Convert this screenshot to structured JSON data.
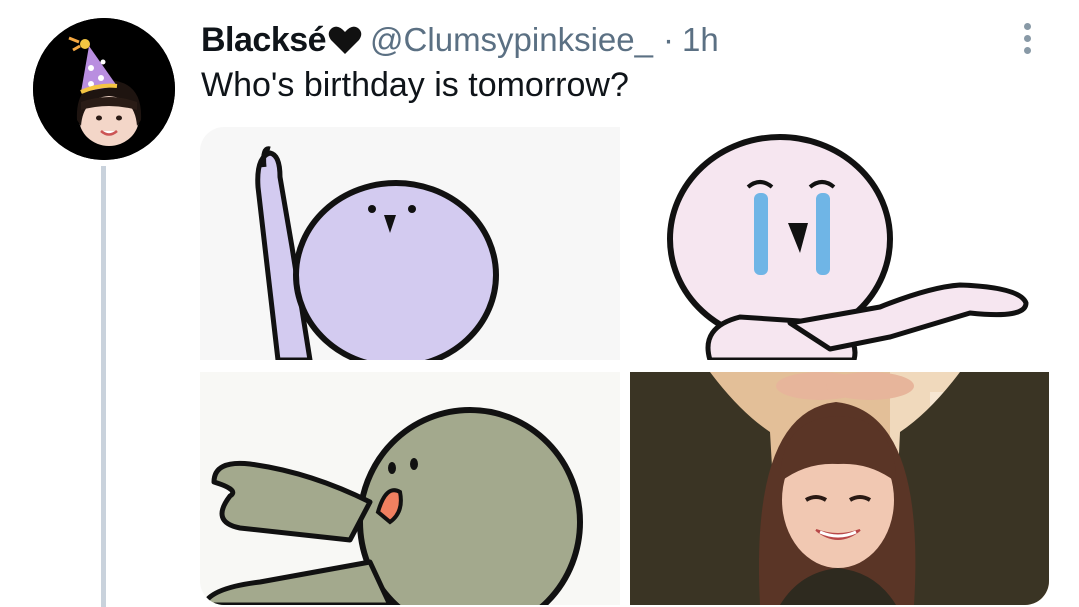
{
  "tweet": {
    "display_name": "Blacksé",
    "handle": "@Clumsypinksiee_",
    "separator": "·",
    "time": "1h",
    "text": "Who's birthday is tomorrow?"
  },
  "avatar": {
    "icon": "party-hat-avatar",
    "background_color": "#000000",
    "hat_color": "#b98ee0"
  },
  "display_name_emoji": "black-heart-icon",
  "media": [
    {
      "name": "purple-blob-raising-hand",
      "body_color": "#d3cbf0"
    },
    {
      "name": "pink-blob-crying-pointing",
      "body_color": "#f6e6f0",
      "tear_color": "#6fb5e6"
    },
    {
      "name": "gray-green-blob-reaching",
      "body_color": "#a3a98d"
    },
    {
      "name": "photo-girl-hands-on-head",
      "background_color": "#e3bf98"
    }
  ],
  "colors": {
    "text_primary": "#0f1419",
    "text_secondary": "#5b7083",
    "thread_line": "#c9d2dc"
  }
}
